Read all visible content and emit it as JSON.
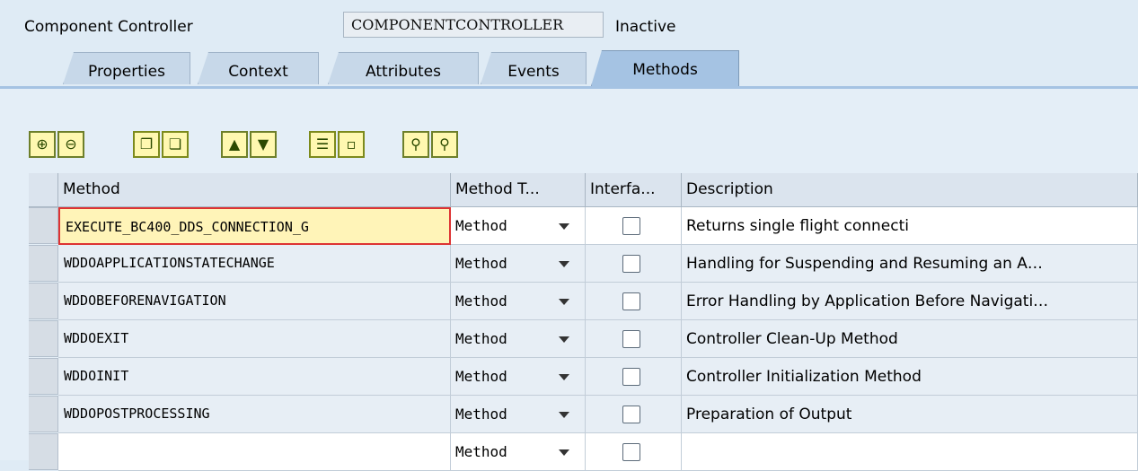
{
  "header": {
    "label": "Component Controller",
    "controller_name": "COMPONENTCONTROLLER",
    "status": "Inactive"
  },
  "tabs": [
    {
      "label": "Properties",
      "active": false
    },
    {
      "label": "Context",
      "active": false
    },
    {
      "label": "Attributes",
      "active": false
    },
    {
      "label": "Events",
      "active": false
    },
    {
      "label": "Methods",
      "active": true
    }
  ],
  "toolbar": {
    "buttons": [
      {
        "icon": "insert-row-icon"
      },
      {
        "icon": "delete-row-icon"
      },
      {
        "icon": "copy-icon"
      },
      {
        "icon": "paste-icon"
      },
      {
        "icon": "move-up-icon"
      },
      {
        "icon": "move-down-icon"
      },
      {
        "icon": "select-all-icon"
      },
      {
        "icon": "deselect-icon"
      },
      {
        "icon": "find-icon"
      },
      {
        "icon": "find-next-icon"
      }
    ]
  },
  "grid": {
    "columns": [
      "Method",
      "Method T...",
      "Interfa...",
      "Description"
    ],
    "rows": [
      {
        "method": "EXECUTE_BC400_DDS_CONNECTION_G",
        "type": "Method",
        "description": "Returns single flight connecti"
      },
      {
        "method": "WDDOAPPLICATIONSTATECHANGE",
        "type": "Method",
        "description": "Handling for Suspending and Resuming an A…"
      },
      {
        "method": "WDDOBEFORENAVIGATION",
        "type": "Method",
        "description": "Error Handling by Application Before Navigati…"
      },
      {
        "method": "WDDOEXIT",
        "type": "Method",
        "description": "Controller Clean-Up Method"
      },
      {
        "method": "WDDOINIT",
        "type": "Method",
        "description": "Controller Initialization Method"
      },
      {
        "method": "WDDOPOSTPROCESSING",
        "type": "Method",
        "description": "Preparation of Output"
      },
      {
        "method": "",
        "type": "Method",
        "description": ""
      }
    ]
  }
}
